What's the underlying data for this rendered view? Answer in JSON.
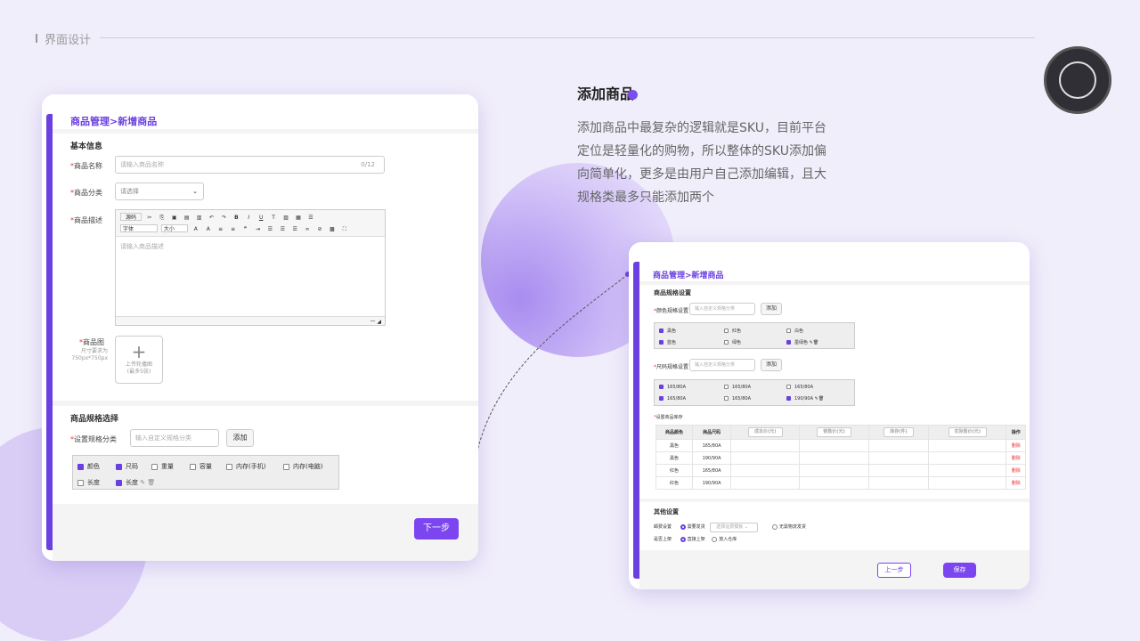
{
  "header": {
    "title": "界面设计"
  },
  "right_panel": {
    "title": "添加商品",
    "desc": "添加商品中最复杂的逻辑就是SKU，目前平台定位是轻量化的购物，所以整体的SKU添加偏向简单化，更多是由用户自己添加编辑，且大规格类最多只能添加两个"
  },
  "card1": {
    "breadcrumb": "商品管理>新增商品",
    "basic_section": "基本信息",
    "name_label": "商品名称",
    "name_placeholder": "请输入商品名称",
    "name_count": "0/12",
    "category_label": "商品分类",
    "category_value": "请选择",
    "desc_label": "商品描述",
    "toolbar": {
      "source": "源码",
      "font": "字体",
      "size": "大小",
      "word_count": "一"
    },
    "desc_placeholder": "请输入商品描述",
    "image_label": "商品图",
    "image_hint1": "尺寸要求为",
    "image_hint2": "750px*750px",
    "upload_text1": "上传轮播图",
    "upload_text2": "(最多5张)",
    "spec_section": "商品规格选择",
    "spec_label": "设置规格分类",
    "spec_placeholder": "输入自定义规格分类",
    "add_button": "添加",
    "options": [
      {
        "label": "颜色",
        "checked": true
      },
      {
        "label": "尺码",
        "checked": true
      },
      {
        "label": "重量",
        "checked": false
      },
      {
        "label": "容量",
        "checked": false
      },
      {
        "label": "内存(手机)",
        "checked": false
      },
      {
        "label": "内存(电脑)",
        "checked": false
      },
      {
        "label": "长度",
        "checked": false
      },
      {
        "label": "长度",
        "checked": true
      }
    ],
    "next_button": "下一步"
  },
  "card2": {
    "breadcrumb": "商品管理>新增商品",
    "spec_section": "商品规格设置",
    "color_label": "颜色规格设置",
    "color_placeholder": "输入自定义规格分类",
    "add_button": "添加",
    "colors": [
      {
        "label": "黑色",
        "checked": true
      },
      {
        "label": "红色",
        "checked": false
      },
      {
        "label": "白色",
        "checked": false
      },
      {
        "label": "蓝色",
        "checked": true
      },
      {
        "label": "绿色",
        "checked": false
      },
      {
        "label": "墨绿色",
        "checked": true
      }
    ],
    "size_label": "尺码规格设置",
    "size_placeholder": "输入自定义规格分类",
    "sizes": [
      {
        "label": "165/80A",
        "checked": true
      },
      {
        "label": "165/80A",
        "checked": false
      },
      {
        "label": "165/80A",
        "checked": false
      },
      {
        "label": "165/80A",
        "checked": true
      },
      {
        "label": "165/80A",
        "checked": false
      },
      {
        "label": "190/90A",
        "checked": true
      }
    ],
    "stock_label": "设置商品库存",
    "table_headers": [
      "商品颜色",
      "商品尺码",
      "成本价(元)",
      "销售价(元)",
      "库存(件)",
      "实际售价(元)",
      "操作"
    ],
    "rows": [
      {
        "color": "黑色",
        "size": "165/80A",
        "op": "删除"
      },
      {
        "color": "黑色",
        "size": "190/90A",
        "op": "删除"
      },
      {
        "color": "红色",
        "size": "165/80A",
        "op": "删除"
      },
      {
        "color": "红色",
        "size": "190/90A",
        "op": "删除"
      }
    ],
    "other_section": "其他设置",
    "shipping_label": "邮费设置",
    "shipping_opt1": "需要发货",
    "shipping_select": "选择运费模板",
    "shipping_opt2": "无需物流发货",
    "shelf_label": "是否上架",
    "shelf_opt1": "直接上架",
    "shelf_opt2": "放入仓库",
    "prev_button": "上一步",
    "save_button": "保存"
  }
}
